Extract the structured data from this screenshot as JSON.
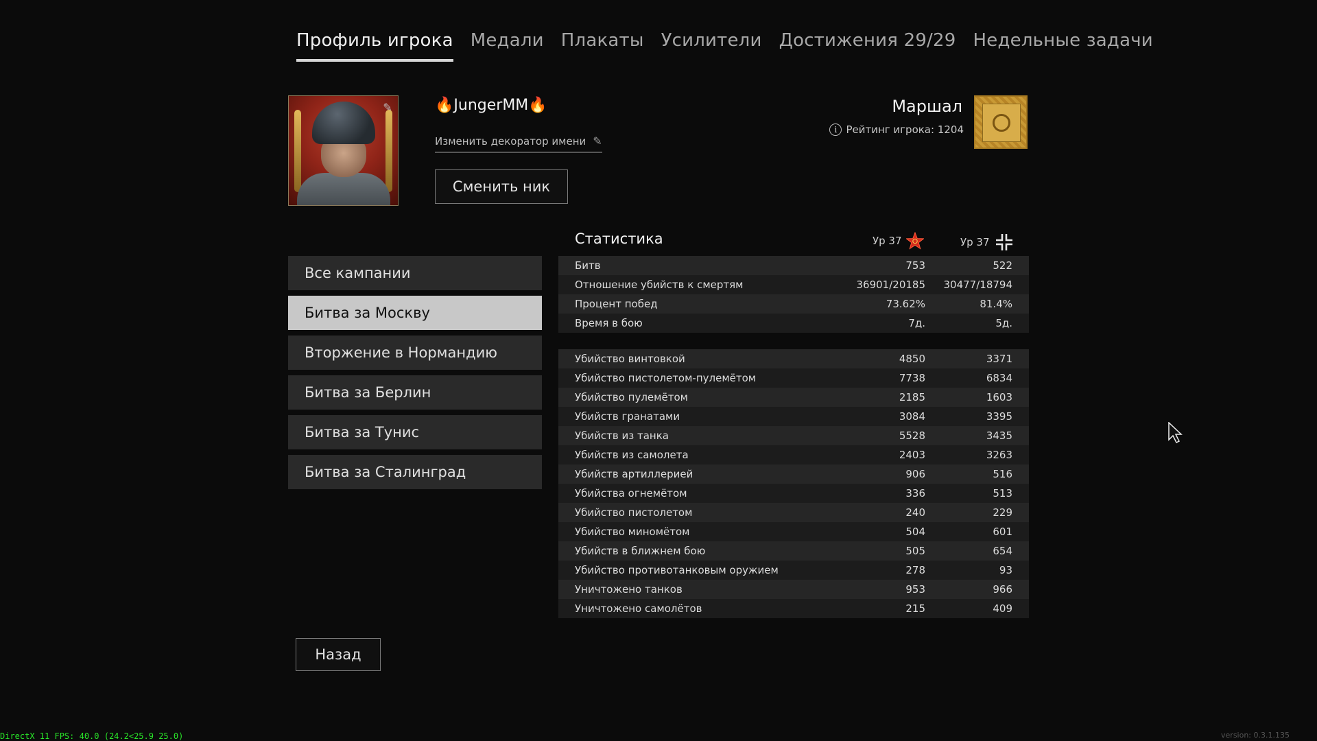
{
  "tabs": [
    {
      "label": "Профиль игрока",
      "active": true
    },
    {
      "label": "Медали",
      "active": false
    },
    {
      "label": "Плакаты",
      "active": false
    },
    {
      "label": "Усилители",
      "active": false
    },
    {
      "label": "Достижения 29/29",
      "active": false
    },
    {
      "label": "Недельные задачи",
      "active": false
    }
  ],
  "profile": {
    "nickname": "🔥JungerMM🔥",
    "decorator_label": "Изменить декоратор имени",
    "change_nick_label": "Сменить ник",
    "rank": "Маршал",
    "rating_label": "Рейтинг игрока: 1204"
  },
  "campaigns": [
    {
      "label": "Все кампании",
      "active": false
    },
    {
      "label": "Битва за Москву",
      "active": true
    },
    {
      "label": "Вторжение в Нормандию",
      "active": false
    },
    {
      "label": "Битва за Берлин",
      "active": false
    },
    {
      "label": "Битва за Тунис",
      "active": false
    },
    {
      "label": "Битва за Сталинград",
      "active": false
    }
  ],
  "stats": {
    "title": "Статистика",
    "level_allies": "Ур 37",
    "level_axis": "Ур 37",
    "summary": [
      {
        "label": "Битв",
        "allies": "753",
        "axis": "522"
      },
      {
        "label": "Отношение убийств к смертям",
        "allies": "36901/20185",
        "axis": "30477/18794"
      },
      {
        "label": "Процент побед",
        "allies": "73.62%",
        "axis": "81.4%"
      },
      {
        "label": "Время в бою",
        "allies": "7д.",
        "axis": "5д."
      }
    ],
    "kills": [
      {
        "label": "Убийство винтовкой",
        "allies": "4850",
        "axis": "3371"
      },
      {
        "label": "Убийство пистолетом-пулемётом",
        "allies": "7738",
        "axis": "6834"
      },
      {
        "label": "Убийство пулемётом",
        "allies": "2185",
        "axis": "1603"
      },
      {
        "label": "Убийств гранатами",
        "allies": "3084",
        "axis": "3395"
      },
      {
        "label": "Убийств из танка",
        "allies": "5528",
        "axis": "3435"
      },
      {
        "label": "Убийств из самолета",
        "allies": "2403",
        "axis": "3263"
      },
      {
        "label": "Убийств артиллерией",
        "allies": "906",
        "axis": "516"
      },
      {
        "label": "Убийства огнемётом",
        "allies": "336",
        "axis": "513"
      },
      {
        "label": "Убийство пистолетом",
        "allies": "240",
        "axis": "229"
      },
      {
        "label": "Убийство миномётом",
        "allies": "504",
        "axis": "601"
      },
      {
        "label": "Убийств в ближнем бою",
        "allies": "505",
        "axis": "654"
      },
      {
        "label": "Убийство противотанковым оружием",
        "allies": "278",
        "axis": "93"
      },
      {
        "label": "Уничтожено танков",
        "allies": "953",
        "axis": "966"
      },
      {
        "label": "Уничтожено самолётов",
        "allies": "215",
        "axis": "409"
      }
    ]
  },
  "back_label": "Назад",
  "fps_text": "DirectX 11 FPS: 40.0 (24.2<25.9 25.0)",
  "version_text": "version: 0.3.1.135",
  "colors": {
    "accent_star": "#d42a1c",
    "rank_gold": "#c99a35",
    "fps_green": "#29e629"
  },
  "icons": {
    "edit": "pencil-icon",
    "info": "info-icon",
    "allies": "red-star-icon",
    "axis": "iron-cross-icon",
    "cursor": "mouse-cursor-icon"
  }
}
